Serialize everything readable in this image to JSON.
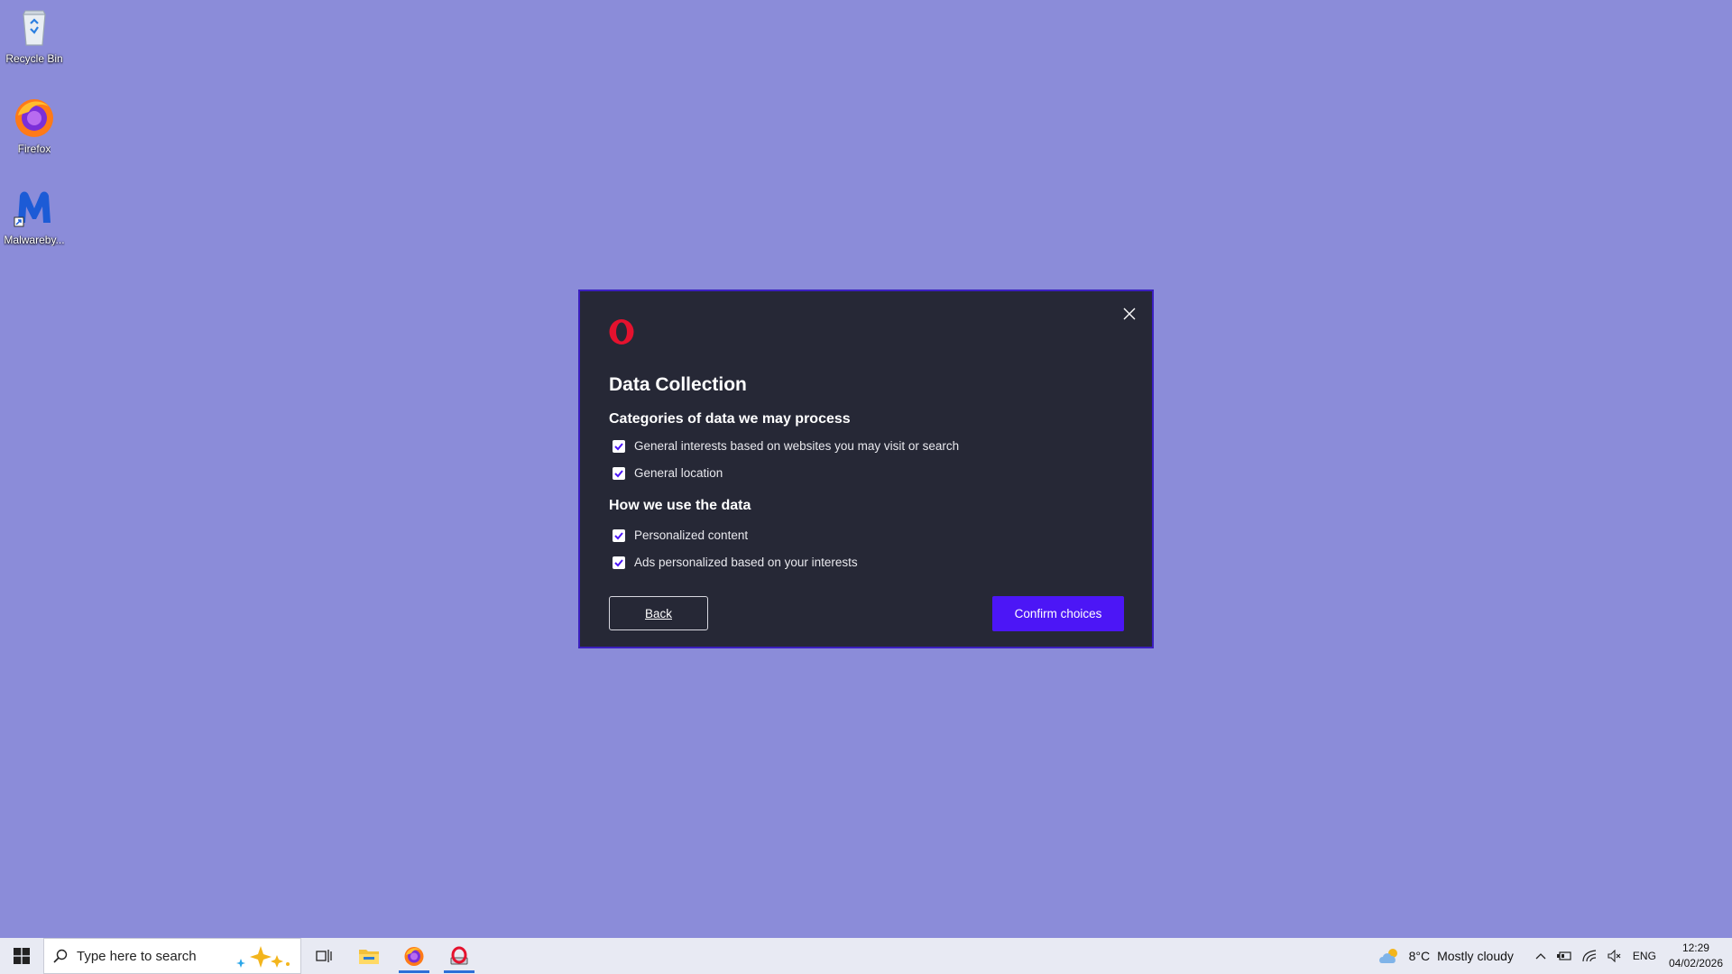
{
  "desktop": {
    "icons": [
      {
        "label": "Recycle Bin",
        "icon": "recycle-bin-icon"
      },
      {
        "label": "Firefox",
        "icon": "firefox-icon"
      },
      {
        "label": "Malwareby...",
        "icon": "malwarebytes-icon"
      }
    ]
  },
  "dialog": {
    "logo": "opera-logo-icon",
    "title": "Data Collection",
    "section1_title": "Categories of data we may process",
    "section1_items": [
      {
        "label": "General interests based on websites you may visit or search",
        "checked": true
      },
      {
        "label": "General location",
        "checked": true
      }
    ],
    "section2_title": "How we use the data",
    "section2_items": [
      {
        "label": "Personalized content",
        "checked": true
      },
      {
        "label": "Ads personalized based on your interests",
        "checked": true
      }
    ],
    "back_label": "Back",
    "confirm_label": "Confirm choices",
    "colors": {
      "background": "#262836",
      "accent": "#4c16f6",
      "logo": "#e5122e"
    }
  },
  "taskbar": {
    "search_placeholder": "Type here to search",
    "pinned": [
      "task-view-icon",
      "file-explorer-icon",
      "firefox-icon",
      "opera-installer-icon"
    ],
    "weather_temp": "8°C",
    "weather_desc": "Mostly cloudy",
    "language": "ENG",
    "time": "12:29",
    "date": "04/02/2026"
  }
}
